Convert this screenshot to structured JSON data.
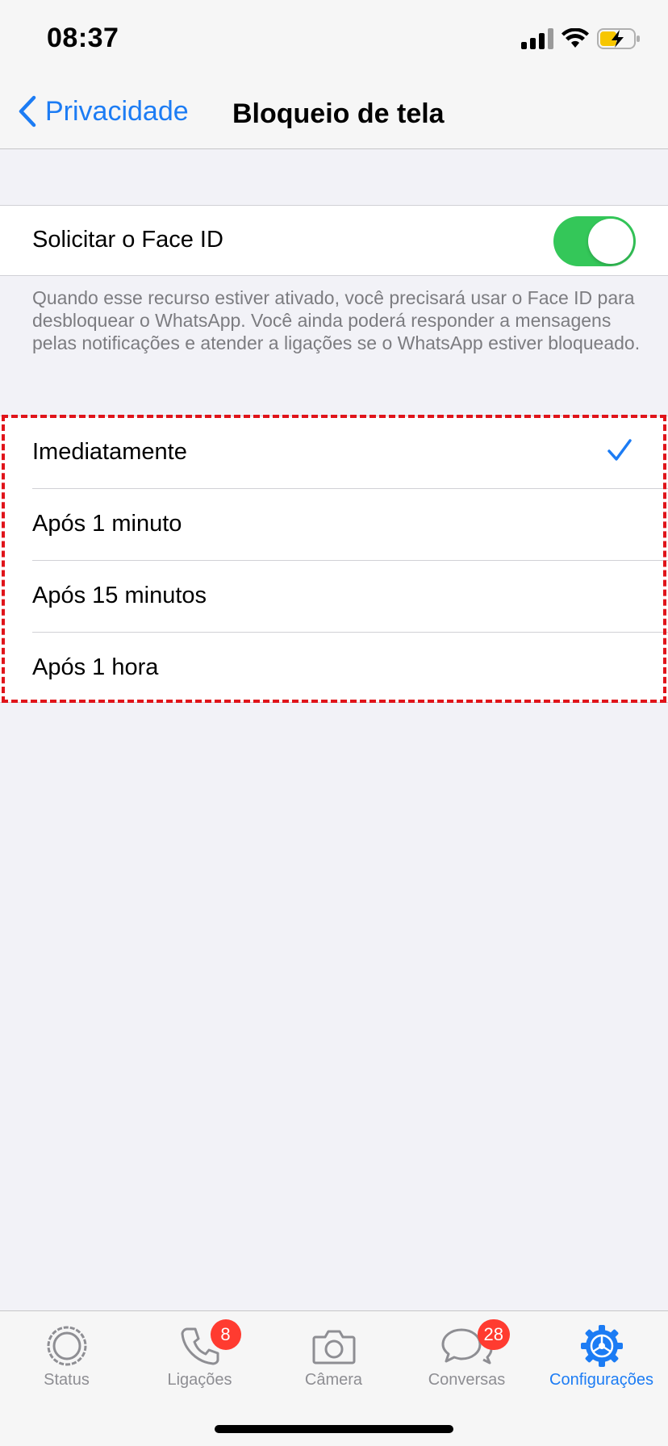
{
  "status_bar": {
    "time": "08:37"
  },
  "nav": {
    "back_label": "Privacidade",
    "title": "Bloqueio de tela"
  },
  "face_id": {
    "label": "Solicitar o Face ID",
    "enabled": true,
    "footer": "Quando esse recurso estiver ativado, você precisará usar o Face ID para desbloquear o WhatsApp. Você ainda poderá responder a mensagens pelas notificações e atender a ligações se o WhatsApp estiver bloqueado."
  },
  "options": [
    {
      "label": "Imediatamente",
      "selected": true
    },
    {
      "label": "Após 1 minuto",
      "selected": false
    },
    {
      "label": "Após 15 minutos",
      "selected": false
    },
    {
      "label": "Após 1 hora",
      "selected": false
    }
  ],
  "tabs": [
    {
      "label": "Status",
      "icon": "status-icon"
    },
    {
      "label": "Ligações",
      "icon": "phone-icon",
      "badge": "8"
    },
    {
      "label": "Câmera",
      "icon": "camera-icon"
    },
    {
      "label": "Conversas",
      "icon": "chat-bubbles-icon",
      "badge": "28"
    },
    {
      "label": "Configurações",
      "icon": "gear-icon",
      "active": true
    }
  ],
  "colors": {
    "accent": "#1c7cf4",
    "toggle_on": "#34c759",
    "badge": "#ff3b30",
    "highlight": "#e0141a"
  }
}
